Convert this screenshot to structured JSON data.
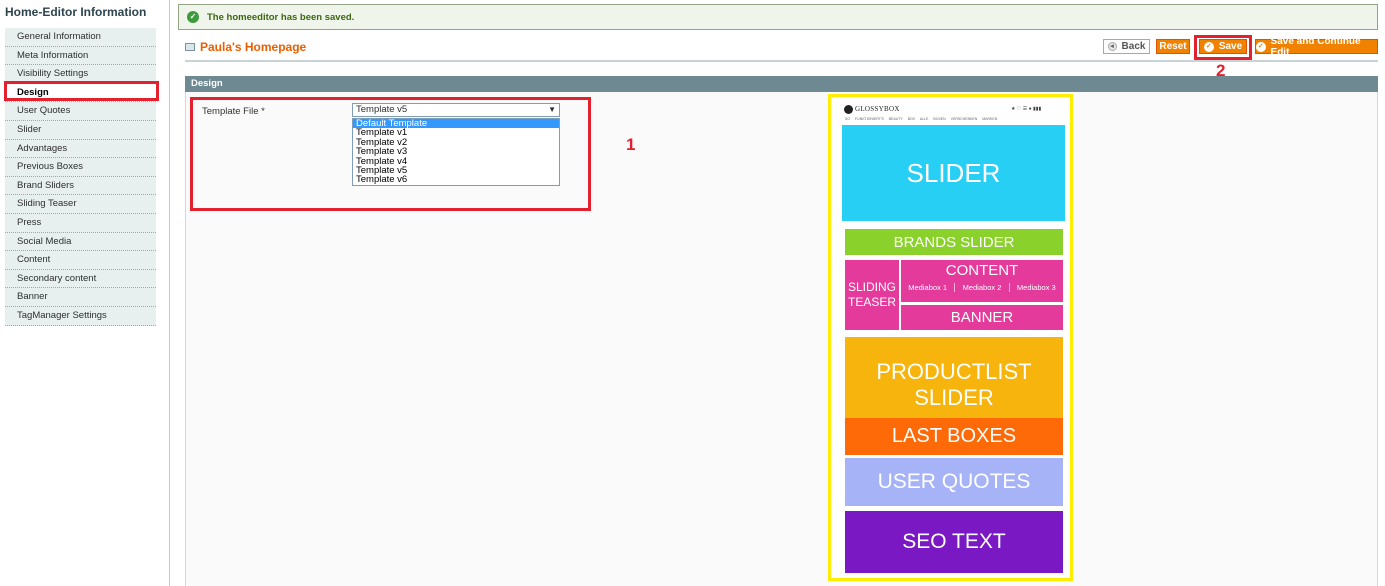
{
  "sidebar": {
    "title": "Home-Editor Information",
    "items": [
      {
        "label": "General Information"
      },
      {
        "label": "Meta Information"
      },
      {
        "label": "Visibility Settings"
      },
      {
        "label": "Design"
      },
      {
        "label": "User Quotes"
      },
      {
        "label": "Slider"
      },
      {
        "label": "Advantages"
      },
      {
        "label": "Previous Boxes"
      },
      {
        "label": "Brand Sliders"
      },
      {
        "label": "Sliding Teaser"
      },
      {
        "label": "Press"
      },
      {
        "label": "Social Media"
      },
      {
        "label": "Content"
      },
      {
        "label": "Secondary content"
      },
      {
        "label": "Banner"
      },
      {
        "label": "TagManager Settings"
      }
    ],
    "active_item": "Design"
  },
  "message": {
    "text": "The homeeditor has been saved.",
    "icon": "check-circle-icon"
  },
  "page": {
    "title": "Paula's Homepage"
  },
  "buttons": {
    "back": "Back",
    "reset": "Reset",
    "save": "Save",
    "save_continue": "Save and Continue Edit"
  },
  "section": {
    "title": "Design"
  },
  "template_field": {
    "label": "Template File *",
    "selected": "Template v5",
    "options": [
      "Default Template",
      "Template v1",
      "Template v2",
      "Template v3",
      "Template v4",
      "Template v5",
      "Template v6"
    ],
    "highlighted_option": "Default Template"
  },
  "annotations": {
    "label_1": "1",
    "label_2": "2",
    "highlight_color": "#e3202e",
    "preview_border_color": "#ffed00"
  },
  "preview": {
    "logo": "GLOSSYBOX",
    "nav": "SO FUNKTIONIERT'S BEAUTY BOX ALLE BOXEN VERSCHENKEN MARKEN",
    "slider": "SLIDER",
    "brands_slider": "BRANDS SLIDER",
    "sliding_teaser_line1": "SLIDING",
    "sliding_teaser_line2": "TEASER",
    "content": "CONTENT",
    "mediabox_1": "Mediabox 1",
    "mediabox_2": "Mediabox 2",
    "mediabox_3": "Mediabox 3",
    "banner": "BANNER",
    "productlist_line1": "PRODUCTLIST",
    "productlist_line2": "SLIDER",
    "last_boxes": "LAST BOXES",
    "user_quotes": "USER QUOTES",
    "seo_text": "SEO TEXT",
    "colors": {
      "slider": "#28cff5",
      "brands_slider": "#8ad22b",
      "content": "#e43a9b",
      "productlist": "#f6b40d",
      "last_boxes": "#ff6a08",
      "user_quotes": "#a6b3f7",
      "seo_text": "#7a19c4"
    }
  }
}
